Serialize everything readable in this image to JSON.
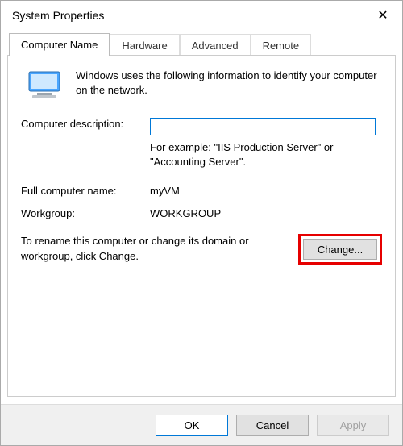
{
  "window": {
    "title": "System Properties",
    "close_glyph": "✕"
  },
  "tabs": {
    "t0": "Computer Name",
    "t1": "Hardware",
    "t2": "Advanced",
    "t3": "Remote"
  },
  "intro": "Windows uses the following information to identify your computer on the network.",
  "desc": {
    "label": "Computer description:",
    "value": "",
    "hint": "For example: \"IIS Production Server\" or \"Accounting Server\"."
  },
  "fullname": {
    "label": "Full computer name:",
    "value": "myVM"
  },
  "workgroup": {
    "label": "Workgroup:",
    "value": "WORKGROUP"
  },
  "rename": {
    "text": "To rename this computer or change its domain or workgroup, click Change.",
    "button": "Change..."
  },
  "buttons": {
    "ok": "OK",
    "cancel": "Cancel",
    "apply": "Apply"
  }
}
